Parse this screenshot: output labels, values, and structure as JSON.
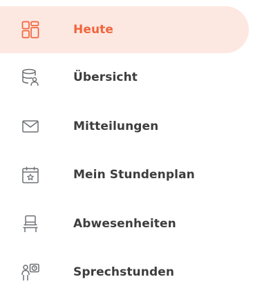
{
  "nav": {
    "items": [
      {
        "label": "Heute",
        "icon": "dashboard-icon",
        "active": true
      },
      {
        "label": "Übersicht",
        "icon": "database-user-icon",
        "active": false
      },
      {
        "label": "Mitteilungen",
        "icon": "envelope-icon",
        "active": false
      },
      {
        "label": "Mein Stundenplan",
        "icon": "calendar-star-icon",
        "active": false
      },
      {
        "label": "Abwesenheiten",
        "icon": "chair-icon",
        "active": false
      },
      {
        "label": "Sprechstunden",
        "icon": "person-clock-icon",
        "active": false
      }
    ]
  },
  "colors": {
    "accent": "#f0643c",
    "active_background": "#fde8e1",
    "text": "#3d3d3d",
    "icon": "#6c6f73"
  }
}
